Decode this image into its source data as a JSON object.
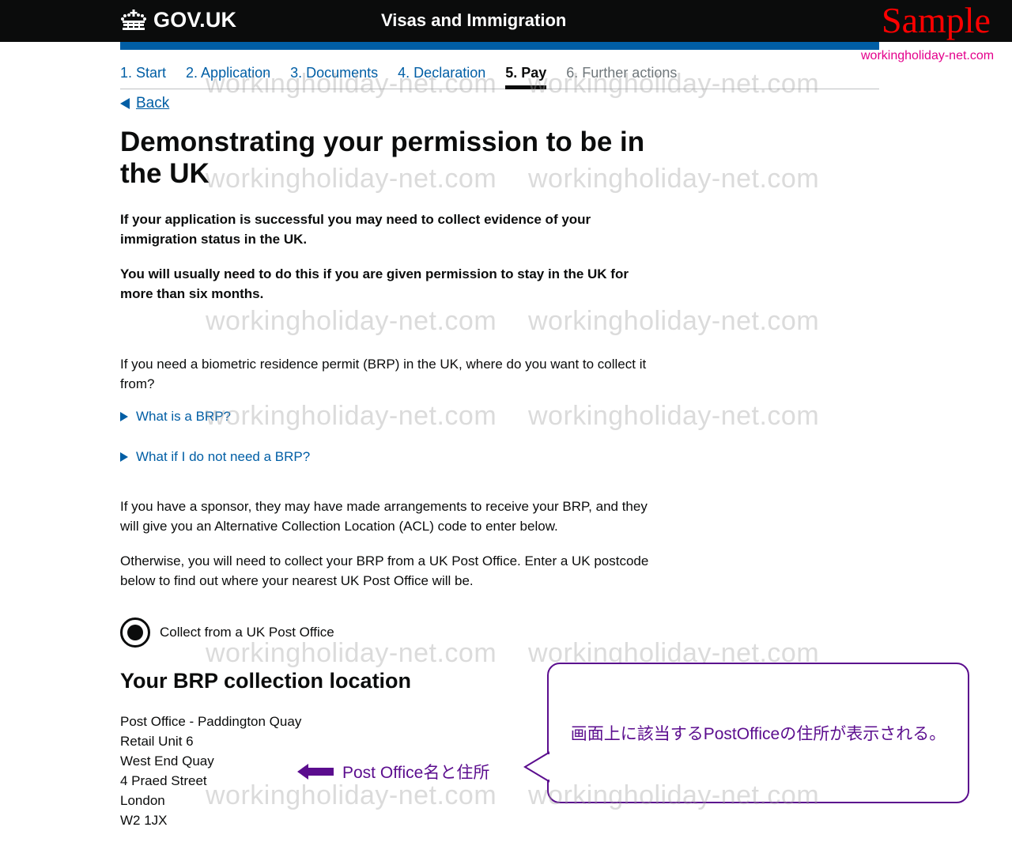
{
  "header": {
    "logo_text": "GOV.UK",
    "logo_icon": "crown-icon",
    "service_name": "Visas and Immigration",
    "sample_label": "Sample",
    "site_credit": "workingholiday-net.com",
    "brand_color": "#005ea5"
  },
  "steps": [
    {
      "label": "1. Start",
      "state": "link"
    },
    {
      "label": "2. Application",
      "state": "link"
    },
    {
      "label": "3. Documents",
      "state": "link"
    },
    {
      "label": "4. Declaration",
      "state": "link"
    },
    {
      "label": "5. Pay",
      "state": "active"
    },
    {
      "label": "6. Further actions",
      "state": "disabled"
    }
  ],
  "back_link": "Back",
  "page_title": "Demonstrating your permission to be in the UK",
  "lead": [
    "If your application is successful you may need to collect evidence of your immigration status in the UK.",
    "You will usually need to do this if you are given permission to stay in the UK for more than six months."
  ],
  "question": "If you need a biometric residence permit (BRP) in the UK, where do you want to collect it from?",
  "details": [
    {
      "label": "What is a BRP?"
    },
    {
      "label": "What if I do not need a BRP?"
    }
  ],
  "paragraphs": [
    "If you have a sponsor, they may have made arrangements to receive your BRP, and they will give you an Alternative Collection Location (ACL) code to enter below.",
    "Otherwise, you will need to collect your BRP from a UK Post Office. Enter a UK postcode below to find out where your nearest UK Post Office will be."
  ],
  "radio": {
    "label": "Collect from a UK Post Office",
    "selected": true
  },
  "section_title": "Your BRP collection location",
  "address": [
    "Post Office - Paddington Quay",
    "Retail Unit 6",
    "West End Quay",
    "4 Praed Street",
    "London",
    "W2 1JX"
  ],
  "watermark": "workingholiday-net.com",
  "annotation": {
    "arrow_label": "Post Office名と住所",
    "callout_text": "画面上に該当するPostOfficeの住所が表示される。",
    "color": "#5b0d8e"
  }
}
